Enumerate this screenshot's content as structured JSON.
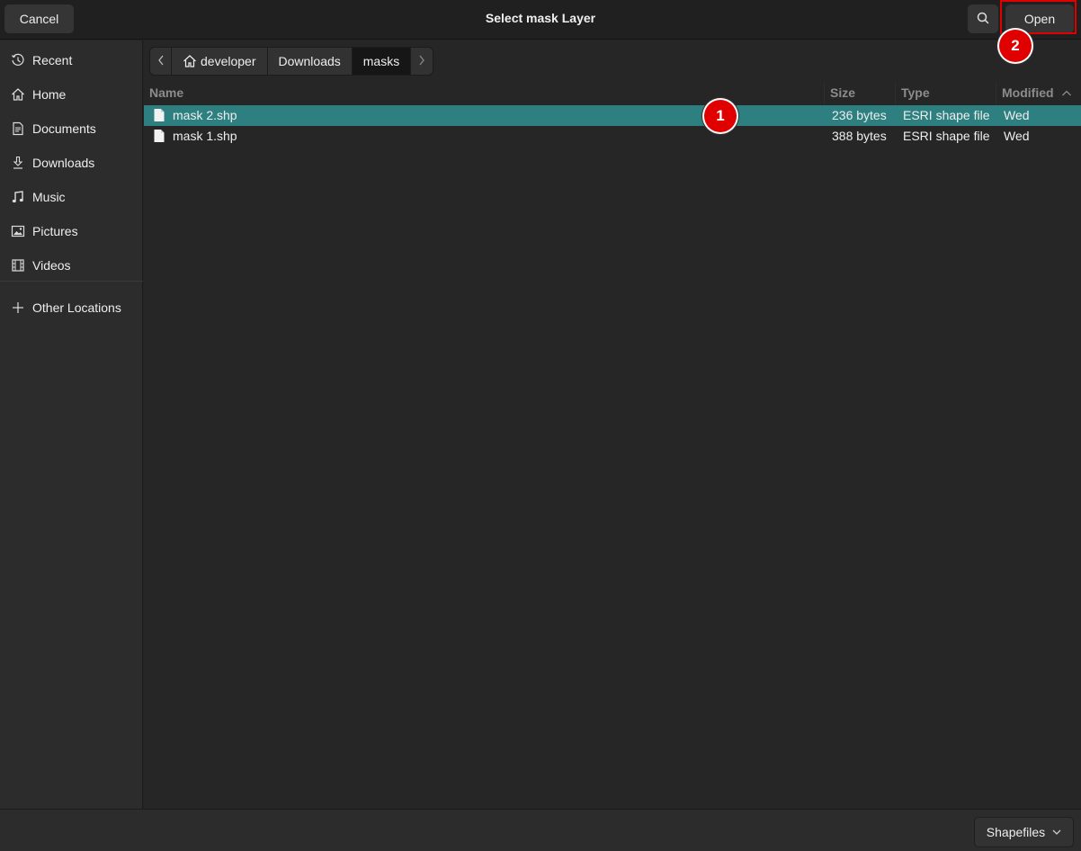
{
  "header": {
    "title": "Select mask Layer",
    "cancel_label": "Cancel",
    "open_label": "Open",
    "search_icon": "search-icon"
  },
  "annotations": {
    "badge_1": "1",
    "badge_2": "2",
    "highlight_color": "#e00000"
  },
  "sidebar": {
    "items": [
      {
        "label": "Recent",
        "icon": "clock-icon"
      },
      {
        "label": "Home",
        "icon": "home-icon"
      },
      {
        "label": "Documents",
        "icon": "document-icon"
      },
      {
        "label": "Downloads",
        "icon": "download-icon"
      },
      {
        "label": "Music",
        "icon": "music-icon"
      },
      {
        "label": "Pictures",
        "icon": "picture-icon"
      },
      {
        "label": "Videos",
        "icon": "video-icon"
      },
      {
        "label": "Other Locations",
        "icon": "plus-icon"
      }
    ]
  },
  "pathbar": {
    "crumbs": [
      "developer",
      "Downloads",
      "masks"
    ],
    "active": "masks"
  },
  "file_list": {
    "columns": [
      "Name",
      "Size",
      "Type",
      "Modified"
    ],
    "sort_column": "Modified",
    "sort_direction": "ascending",
    "rows": [
      {
        "name": "mask 2.shp",
        "size": "236 bytes",
        "type": "ESRI shape file",
        "modified": "Wed",
        "selected": true
      },
      {
        "name": "mask 1.shp",
        "size": "388 bytes",
        "type": "ESRI shape file",
        "modified": "Wed",
        "selected": false
      }
    ],
    "selection_color": "#2e8080"
  },
  "footer": {
    "filter_label": "Shapefiles"
  }
}
